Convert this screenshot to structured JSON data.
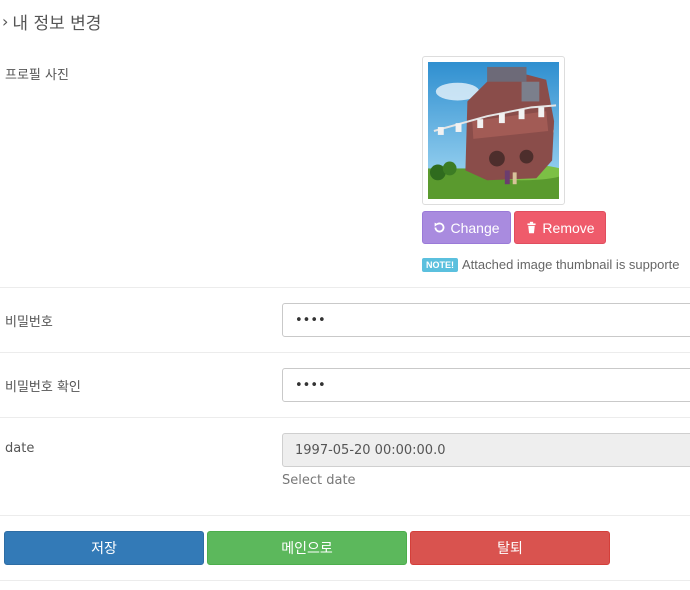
{
  "page": {
    "title": "내 정보 변경"
  },
  "profile": {
    "label": "프로필 사진",
    "change_label": "Change",
    "remove_label": "Remove",
    "note_badge": "NOTE!",
    "note_text": "Attached image thumbnail is supporte"
  },
  "password": {
    "label": "비밀번호",
    "value": "••••"
  },
  "password_confirm": {
    "label": "비밀번호 확인",
    "value": "••••"
  },
  "date": {
    "label": "date",
    "value": "1997-05-20 00:00:00.0",
    "hint": "Select date"
  },
  "actions": {
    "save": "저장",
    "main": "메인으로",
    "leave": "탈퇴"
  },
  "colors": {
    "change": "#a98bdf",
    "remove": "#ef5b6b",
    "save": "#337ab7",
    "main": "#5cb85c",
    "leave": "#d9534f"
  },
  "icons": {
    "heading": "chevron-right-icon",
    "change": "undo-icon",
    "remove": "trash-icon"
  }
}
